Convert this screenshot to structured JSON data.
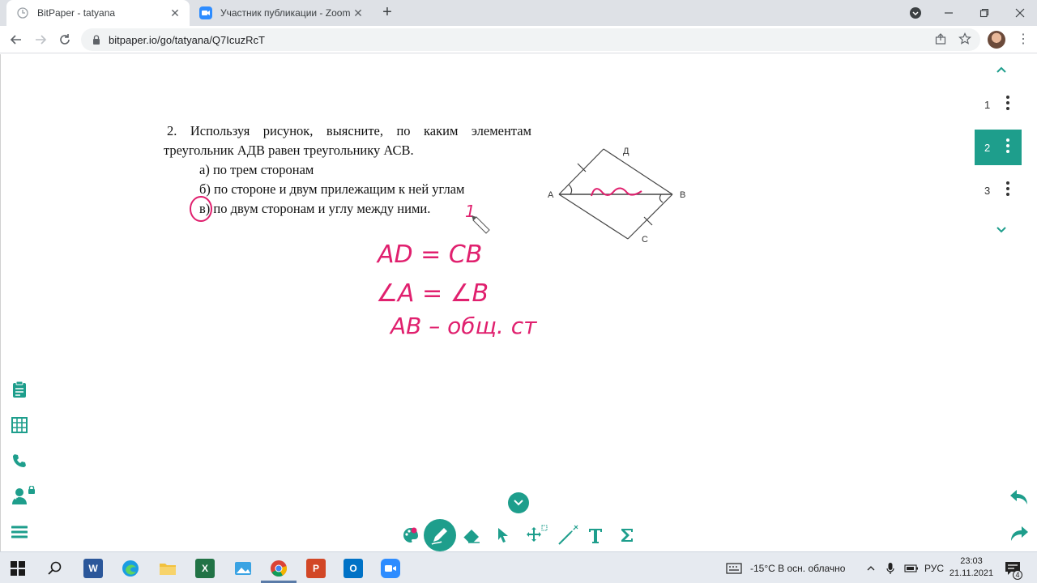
{
  "browser": {
    "tabs": [
      {
        "title": "BitPaper - tatyana",
        "active": true
      },
      {
        "title": "Участник публикации - Zoom",
        "active": false
      }
    ],
    "url": "bitpaper.io/go/tatyana/Q7IcuzRcT"
  },
  "problem": {
    "stem": "2. Используя рисунок, выясните, по каким элементам треугольник АДВ равен треугольнику АСВ.",
    "options": [
      "а) по трем сторонам",
      "б) по стороне и двум прилежащим к ней углам",
      "в) по двум сторонам и углу между ними."
    ]
  },
  "diagram": {
    "labels": {
      "A": "A",
      "D": "Д",
      "B": "B",
      "C": "C"
    }
  },
  "handwriting": {
    "line1": "AD = CB",
    "line2": "∠A = ∠B",
    "line3": "AB – общ. ст",
    "mark": "1",
    "color": "#e0206e"
  },
  "pages": {
    "items": [
      "1",
      "2",
      "3"
    ],
    "active_index": 1
  },
  "taskbar": {
    "weather": "-15°C  В осн. облачно",
    "lang": "РУС",
    "time": "23:03",
    "date": "21.11.2021",
    "notifications": "4"
  },
  "colors": {
    "accent": "#1e9e8c",
    "ink": "#e0206e"
  }
}
